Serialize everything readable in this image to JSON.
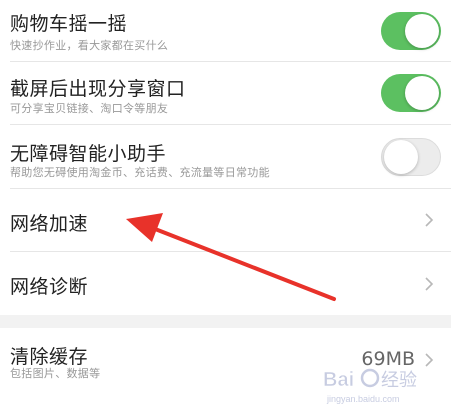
{
  "settings": [
    {
      "title": "购物车摇一摇",
      "subtitle": "快速抄作业，看大家都在买什么",
      "toggle": "on"
    },
    {
      "title": "截屏后出现分享窗口",
      "subtitle": "可分享宝贝链接、淘口令等朋友",
      "toggle": "on"
    },
    {
      "title": "无障碍智能小助手",
      "subtitle": "帮助您无碍使用淘金币、充话费、充流量等日常功能",
      "toggle": "off"
    },
    {
      "title": "网络加速"
    },
    {
      "title": "网络诊断"
    }
  ],
  "cache": {
    "title": "清除缓存",
    "subtitle": "包括图片、数据等",
    "value": "69MB"
  },
  "colors": {
    "toggle_on": "#5cc061",
    "annotation_arrow": "#e8322a"
  },
  "watermark": {
    "text": "Baidu 经验",
    "url": "jingyan.baidu.com"
  }
}
